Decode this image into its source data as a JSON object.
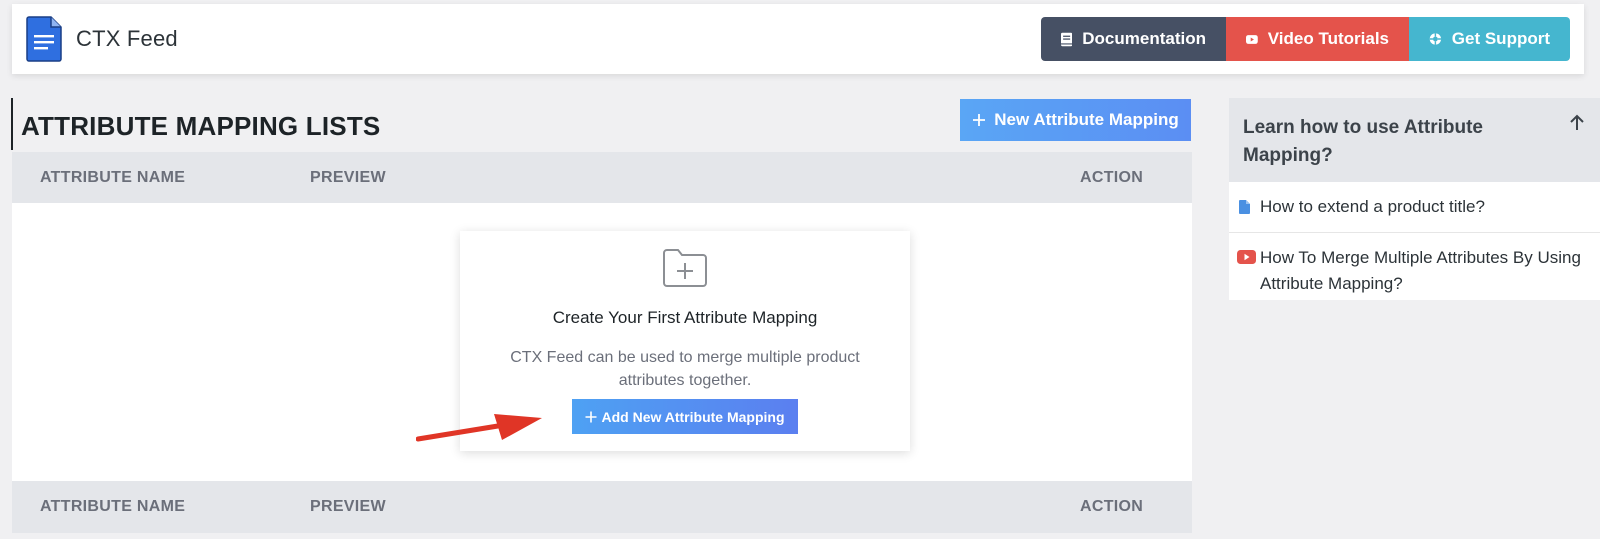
{
  "header": {
    "app_title": "CTX Feed",
    "logo_icon": "document-logo-icon",
    "buttons": {
      "documentation": "Documentation",
      "video_tutorials": "Video Tutorials",
      "get_support": "Get Support"
    },
    "colors": {
      "documentation": "#465064",
      "video_tutorials": "#e4534b",
      "get_support": "#45b6cf"
    }
  },
  "main": {
    "page_title": "ATTRIBUTE MAPPING LISTS",
    "new_button_label": "New Attribute Mapping",
    "table": {
      "columns": [
        "ATTRIBUTE NAME",
        "PREVIEW",
        "ACTION"
      ]
    },
    "empty_state": {
      "icon": "folder-plus-icon",
      "title": "Create Your First Attribute Mapping",
      "description": "CTX Feed can be used to merge multiple product attributes together.",
      "button_label": "Add New Attribute Mapping"
    }
  },
  "sidebar": {
    "title": "Learn how to use Attribute Mapping?",
    "items": [
      {
        "label": "How to extend a product title?",
        "icon": "document-icon"
      },
      {
        "label": "How To Merge Multiple Attributes By Using Attribute Mapping?",
        "icon": "youtube-icon"
      }
    ]
  }
}
